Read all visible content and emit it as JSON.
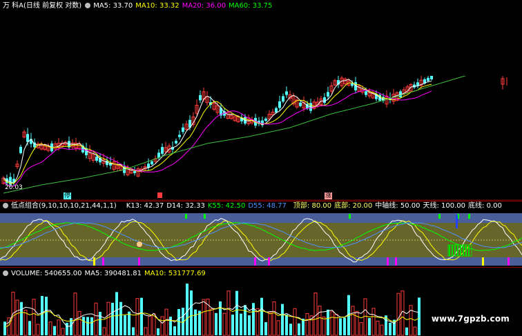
{
  "price_header": {
    "stock": "万 科A",
    "mode": "(日线 前复权 对数)",
    "ma5": "MA5: 33.70",
    "ma10": "MA10: 33.32",
    "ma20": "MA20: 36.00",
    "ma60": "MA60: 33.75"
  },
  "price_low_label": "20.03",
  "markers": {
    "m1": "停",
    "m2": "涨"
  },
  "osc_header": {
    "name": "低点组合(9,10,10,10,21,44,1,1)",
    "k13": "K13: 42.37",
    "d14": "D14: 32.33",
    "k55": "K55: 42.50",
    "d55": "D55: 48.77",
    "top": "顶部: 80.00",
    "bottom": "底部: 20.00",
    "axis": "中轴线: 50.00",
    "sky": "天线: 100.00",
    "ground": "底线: 0.00"
  },
  "vol_header": {
    "volume": "VOLUME: 540655.00",
    "ma5": "MA5: 390481.81",
    "ma10": "MA10: 531777.69"
  },
  "watermark": "www.7gpzb.com",
  "colors": {
    "up": "#ff3b3b",
    "down": "#54ffff",
    "ma5": "#ffffff",
    "ma10": "#ffff00",
    "ma20": "#ff00ff",
    "ma60": "#00ff00",
    "osc_band": "#66662b",
    "osc_blue": "#4a5f9a"
  }
}
